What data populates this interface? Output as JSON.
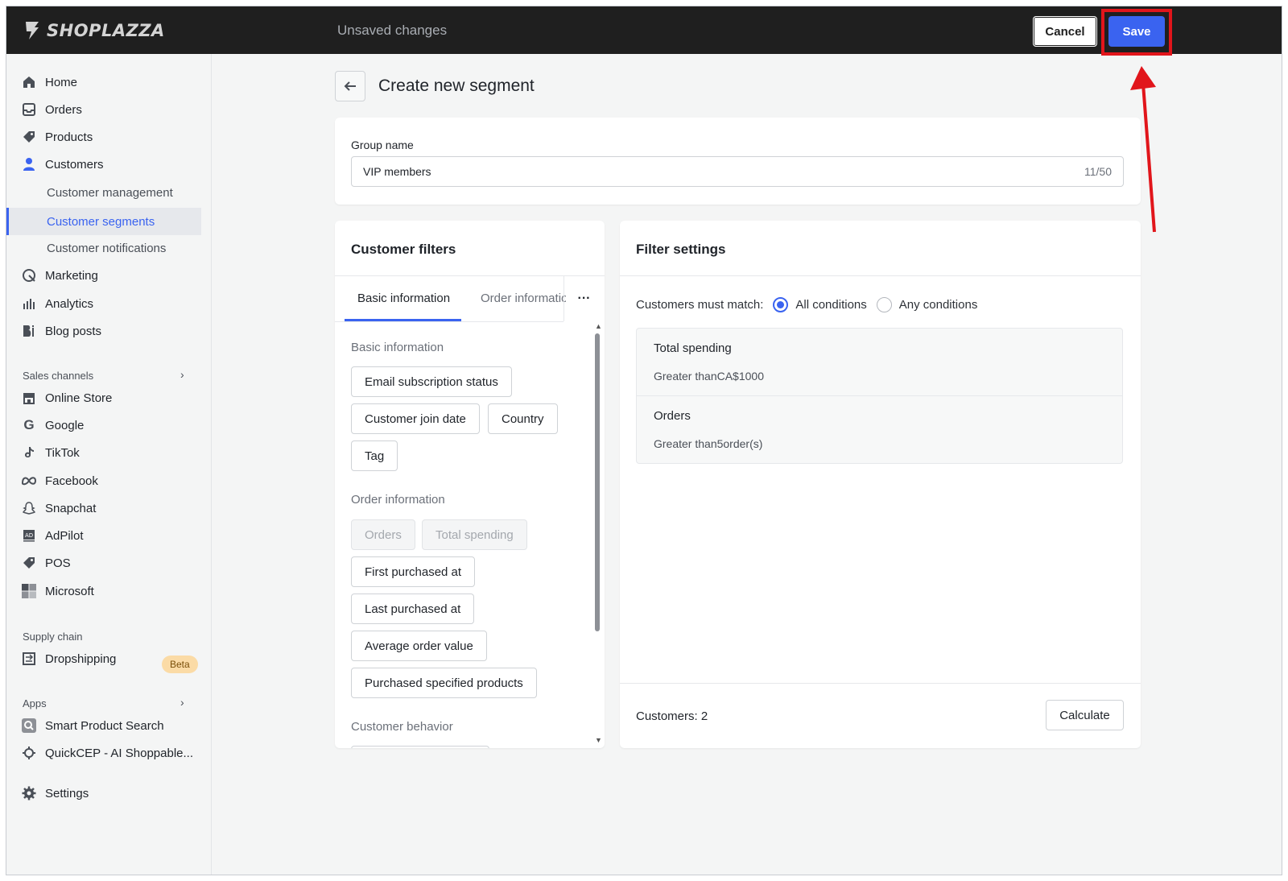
{
  "topbar": {
    "brand": "SHOPLAZZA",
    "status": "Unsaved changes",
    "cancel_label": "Cancel",
    "save_label": "Save",
    "highlight_color": "#e1151b",
    "accent_color": "#3a63f0"
  },
  "sidebar": {
    "items": [
      {
        "label": "Home",
        "icon": "home-icon"
      },
      {
        "label": "Orders",
        "icon": "inbox-icon"
      },
      {
        "label": "Products",
        "icon": "tag-icon"
      },
      {
        "label": "Customers",
        "icon": "person-icon"
      }
    ],
    "customer_subitems": [
      {
        "label": "Customer management"
      },
      {
        "label": "Customer segments",
        "active": true
      },
      {
        "label": "Customer notifications"
      }
    ],
    "items_after": [
      {
        "label": "Marketing",
        "icon": "marketing-icon"
      },
      {
        "label": "Analytics",
        "icon": "analytics-icon"
      },
      {
        "label": "Blog posts",
        "icon": "blog-icon"
      }
    ],
    "sales_channels_label": "Sales channels",
    "sales_channels": [
      {
        "label": "Online Store",
        "icon": "store-icon"
      },
      {
        "label": "Google",
        "icon": "google-icon"
      },
      {
        "label": "TikTok",
        "icon": "tiktok-icon"
      },
      {
        "label": "Facebook",
        "icon": "meta-icon"
      },
      {
        "label": "Snapchat",
        "icon": "snapchat-icon"
      },
      {
        "label": "AdPilot",
        "icon": "adpilot-icon"
      },
      {
        "label": "POS",
        "icon": "pos-tag-icon"
      },
      {
        "label": "Microsoft",
        "icon": "microsoft-icon"
      }
    ],
    "supply_chain_label": "Supply chain",
    "dropshipping_label": "Dropshipping",
    "beta_label": "Beta",
    "apps_label": "Apps",
    "apps": [
      {
        "label": "Smart Product Search",
        "icon": "search-app-icon"
      },
      {
        "label": "QuickCEP - AI Shoppable...",
        "icon": "quickcep-icon"
      }
    ],
    "settings_label": "Settings"
  },
  "main": {
    "title": "Create new segment",
    "group_name_label": "Group name",
    "group_name_value": "VIP members",
    "group_name_count": "11/50",
    "filters": {
      "title": "Customer filters",
      "tabs": [
        "Basic information",
        "Order information"
      ],
      "more": "···",
      "basic_label": "Basic information",
      "basic_chips": [
        "Email subscription status",
        "Customer join date",
        "Country",
        "Tag"
      ],
      "order_label": "Order information",
      "order_chips": [
        "Orders",
        "Total spending",
        "First purchased at",
        "Last purchased at",
        "Average order value",
        "Purchased specified products"
      ],
      "behavior_label": "Customer behavior"
    },
    "settings": {
      "title": "Filter settings",
      "match_label": "Customers must match:",
      "option_all": "All conditions",
      "option_any": "Any conditions",
      "selected": "All conditions",
      "conditions": [
        {
          "title": "Total spending",
          "desc": "Greater thanCA$1000"
        },
        {
          "title": "Orders",
          "desc": "Greater than5order(s)"
        }
      ],
      "customers_count": "Customers: 2",
      "calculate_label": "Calculate"
    }
  }
}
